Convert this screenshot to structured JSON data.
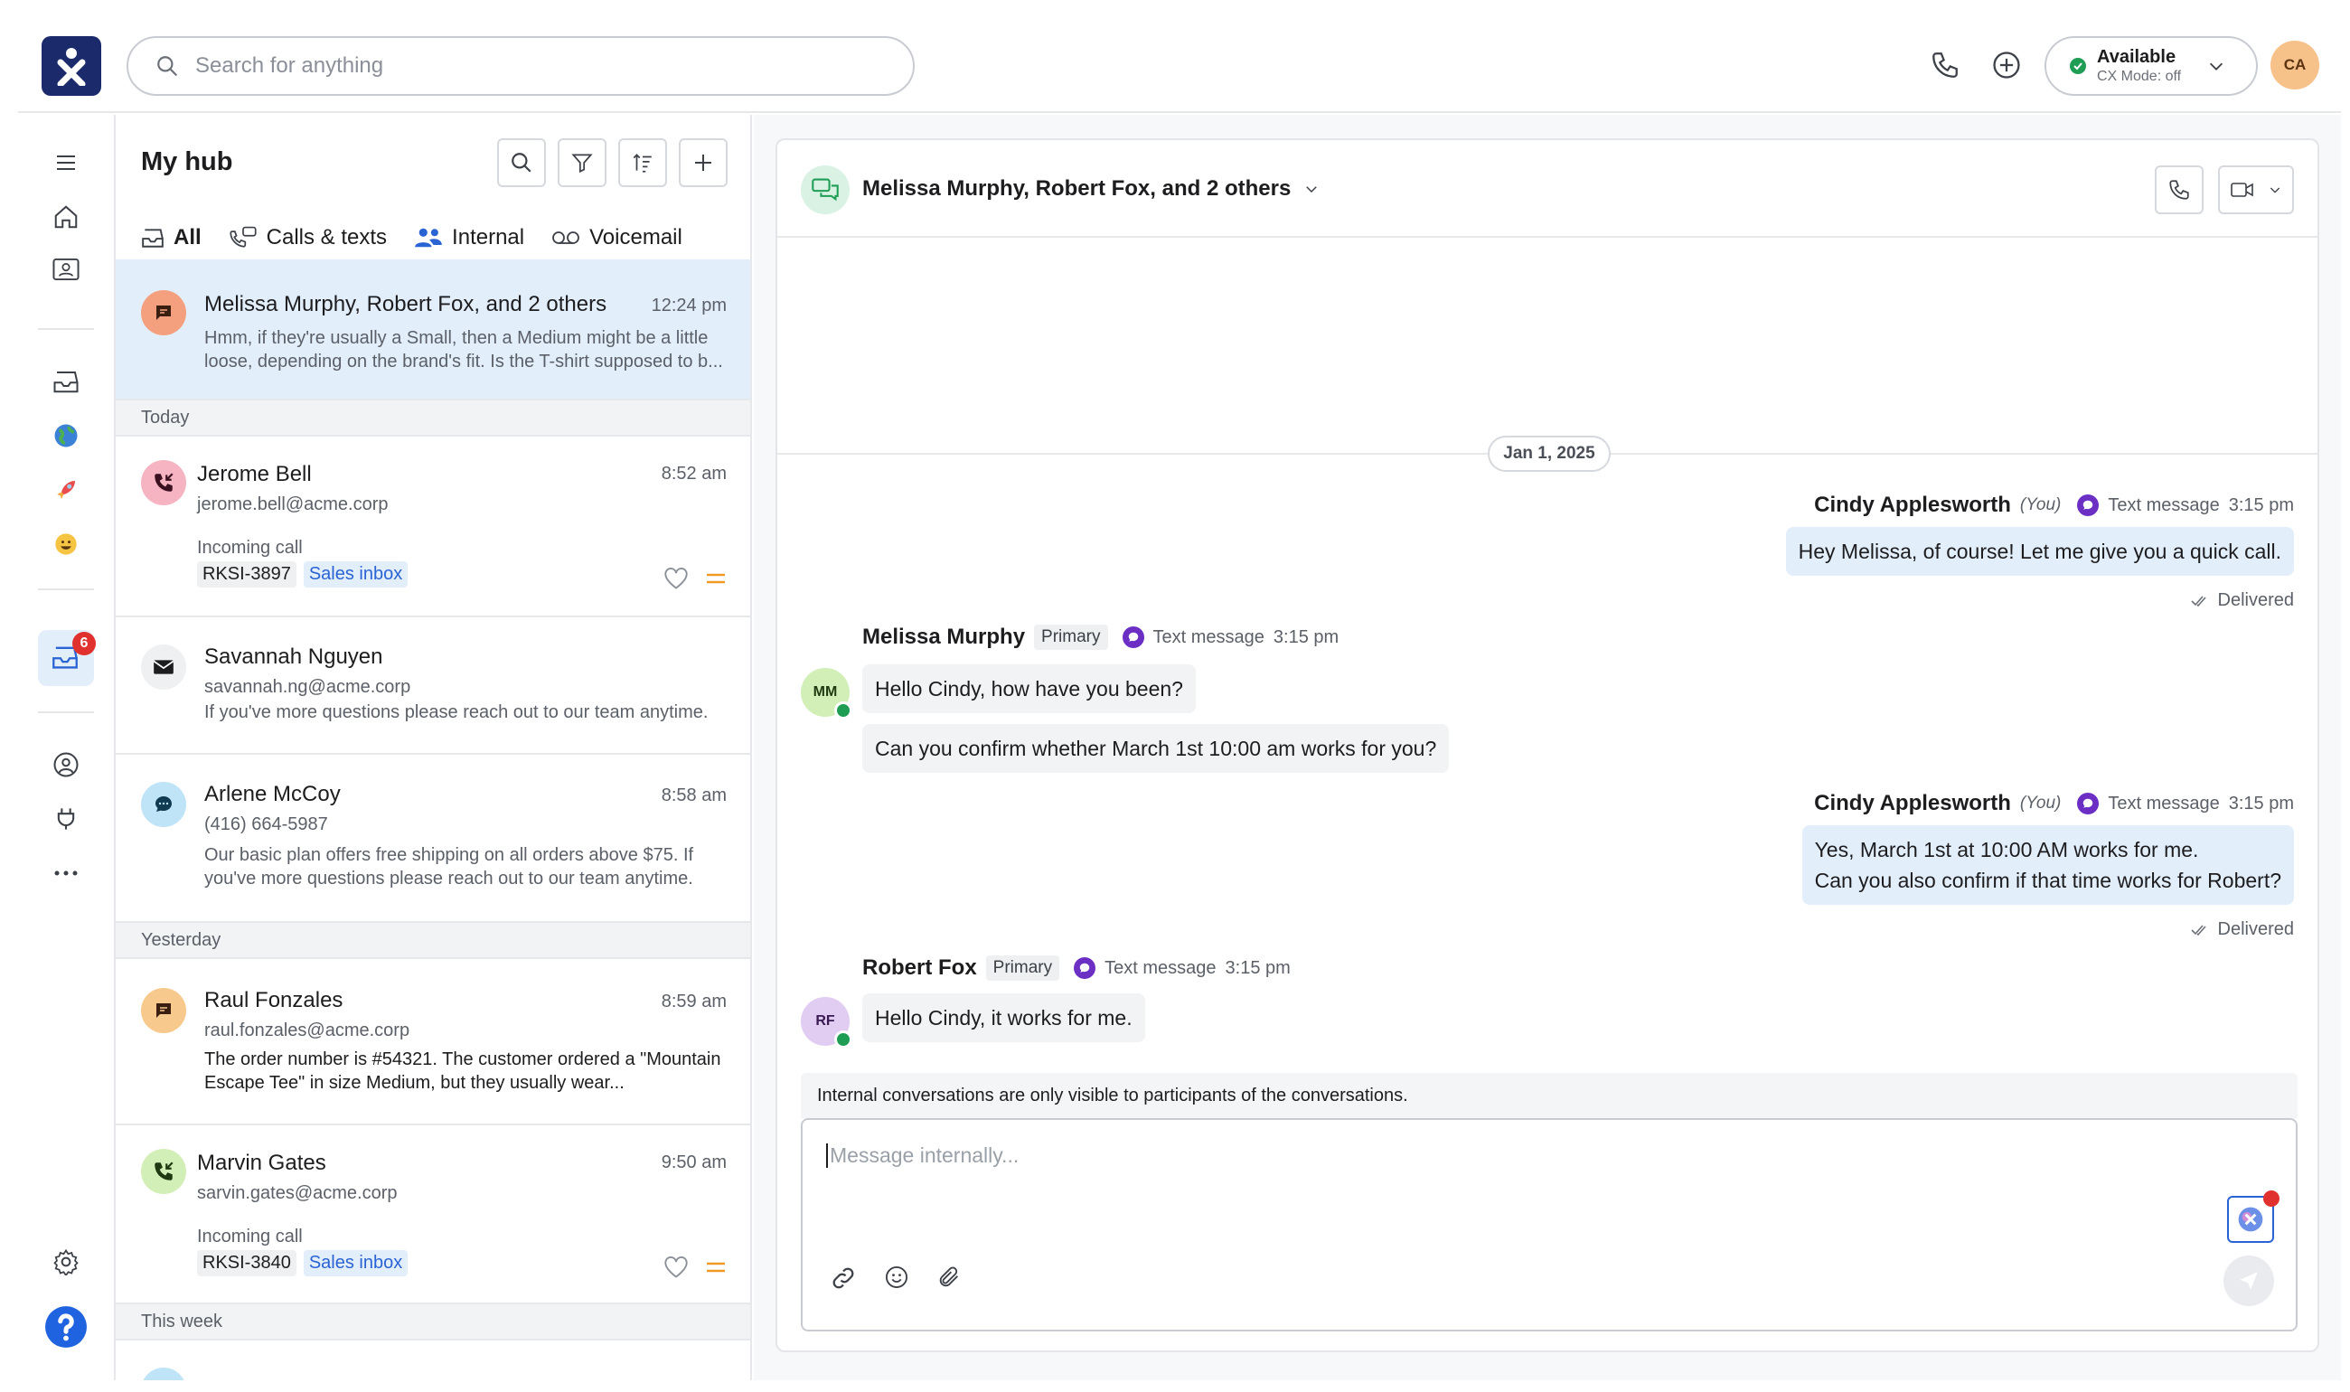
{
  "search": {
    "placeholder": "Search for anything"
  },
  "top": {
    "status_label": "Available",
    "status_sub": "CX Mode: off",
    "user_initials": "CA",
    "icons": [
      "phone-icon",
      "add-circle-icon",
      "chevron-down-icon"
    ]
  },
  "rail": {
    "inbox_badge": "6",
    "icons": [
      "menu-icon",
      "home-icon",
      "contacts-icon",
      "inbox-tray-icon",
      "globe-icon",
      "rocket-icon",
      "smiley-icon",
      "inbox-icon",
      "user-circle-icon",
      "plug-icon",
      "more-icon",
      "settings-icon",
      "help-icon"
    ]
  },
  "hub": {
    "title": "My hub",
    "tabs": [
      {
        "label": "All",
        "icon": "inbox-icon"
      },
      {
        "label": "Calls & texts",
        "icon": "call-text-icon"
      },
      {
        "label": "Internal",
        "icon": "people-icon"
      },
      {
        "label": "Voicemail",
        "icon": "voicemail-icon"
      }
    ],
    "sections": {
      "today": "Today",
      "yesterday": "Yesterday",
      "this_week": "This week"
    },
    "items": [
      {
        "name": "Melissa Murphy, Robert Fox, and 2 others",
        "time": "12:24 pm",
        "preview": "Hmm, if they're usually a Small, then a Medium might be a little loose, depending on the brand's fit. Is the T-shirt supposed to b...",
        "icon": "chat-icon",
        "color": "#f4a07f"
      },
      {
        "name": "Jerome Bell",
        "time": "8:52 am",
        "sub": "jerome.bell@acme.corp",
        "kind": "Incoming call",
        "ticket": "RKSI-3897",
        "inbox": "Sales inbox",
        "icon": "incoming-call-icon",
        "color": "#f6b4c3"
      },
      {
        "name": "Savannah Nguyen",
        "sub": "savannah.ng@acme.corp",
        "preview": "If you've more questions please reach out to our team anytime.",
        "icon": "mail-icon",
        "color": "#eef0f2"
      },
      {
        "name": "Arlene McCoy",
        "time": "8:58 am",
        "sub": "(416) 664-5987",
        "preview": "Our basic plan offers free shipping on all orders above $75. If you've more questions please reach out to our team anytime.",
        "icon": "sms-icon",
        "color": "#bfe3f7"
      },
      {
        "name": "Raul Fonzales",
        "time": "8:59 am",
        "sub": "raul.fonzales@acme.corp",
        "preview": "The order number is #54321. The customer ordered a \"Mountain Escape Tee\" in size Medium, but they usually wear...",
        "icon": "chat-icon",
        "color": "#f8c98c"
      },
      {
        "name": "Marvin Gates",
        "time": "9:50 am",
        "sub": "sarvin.gates@acme.corp",
        "kind": "Incoming call",
        "ticket": "RKSI-3840",
        "inbox": "Sales inbox",
        "icon": "incoming-call-icon",
        "color": "#d3efb8"
      }
    ]
  },
  "chat": {
    "title": "Melissa Murphy, Robert Fox, and 2 others",
    "date": "Jan 1, 2025",
    "you_tag": "(You)",
    "primary_tag": "Primary",
    "channel": "Text message",
    "delivered": "Delivered",
    "messages": [
      {
        "sender": "Cindy Applesworth",
        "time": "3:15 pm",
        "lines": [
          "Hey Melissa, of course! Let me give you a quick call."
        ]
      },
      {
        "sender": "Melissa Murphy",
        "initials": "MM",
        "time": "3:15 pm",
        "lines": [
          "Hello Cindy, how have you been?",
          "Can you confirm whether March 1st 10:00 am works for you?"
        ]
      },
      {
        "sender": "Cindy Applesworth",
        "time": "3:15 pm",
        "lines": [
          "Yes, March 1st at 10:00 AM works for me.",
          "Can you also confirm if that time works for Robert?"
        ]
      },
      {
        "sender": "Robert Fox",
        "initials": "RF",
        "time": "3:15 pm",
        "lines": [
          "Hello Cindy, it works for me."
        ]
      }
    ],
    "notice": "Internal conversations are only visible to participants of the conversations.",
    "composer_placeholder": "Message internally..."
  }
}
